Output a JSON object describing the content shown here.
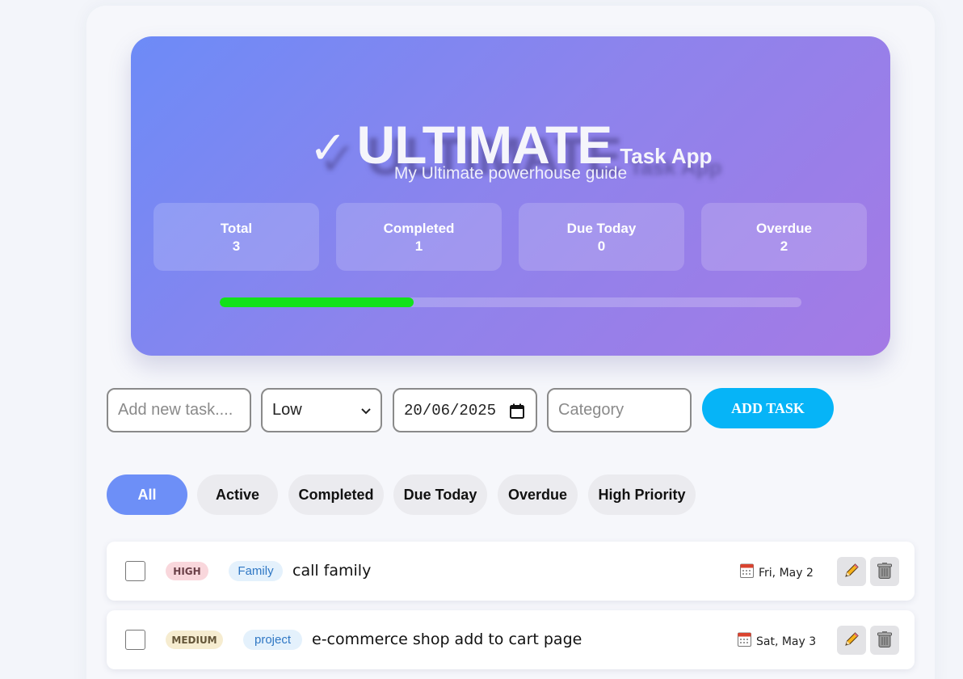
{
  "header": {
    "check_glyph": "✓",
    "title_main": "ULTIMATE",
    "title_sub": "Task App",
    "subtitle": "My Ultimate powerhouse guide"
  },
  "stats": [
    {
      "label": "Total",
      "value": "3"
    },
    {
      "label": "Completed",
      "value": "1"
    },
    {
      "label": "Due Today",
      "value": "0"
    },
    {
      "label": "Overdue",
      "value": "2"
    }
  ],
  "progress": {
    "fraction": 0.333
  },
  "form": {
    "task_placeholder": "Add new task....",
    "priority_value": "Low",
    "date_value": "20/06/2025",
    "category_placeholder": "Category",
    "add_label": "ADD TASK"
  },
  "filters": [
    {
      "label": "All",
      "active": true
    },
    {
      "label": "Active",
      "active": false
    },
    {
      "label": "Completed",
      "active": false
    },
    {
      "label": "Due Today",
      "active": false
    },
    {
      "label": "Overdue",
      "active": false
    },
    {
      "label": "High Priority",
      "active": false
    }
  ],
  "tasks": [
    {
      "priority": "HIGH",
      "category": "Family",
      "text": "call family",
      "due": "Fri, May 2",
      "completed": false
    },
    {
      "priority": "MEDIUM",
      "category": "project",
      "text": "e-commerce shop add to cart page",
      "due": "Sat, May 3",
      "completed": false
    }
  ],
  "colors": {
    "accent": "#6d8ff7",
    "add_button": "#06b4f7",
    "progress_fill": "#12e21a"
  },
  "icons": {
    "calendar": "calendar-icon",
    "edit": "pencil-icon",
    "delete": "trash-icon",
    "select_caret": "chevron-down-icon"
  }
}
